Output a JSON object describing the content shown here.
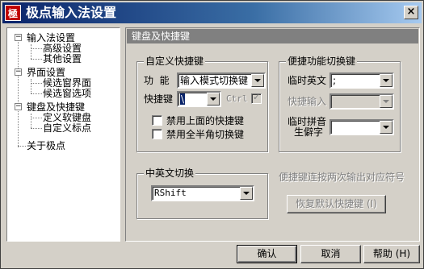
{
  "window": {
    "title": "极点输入法设置",
    "icon_char": "極",
    "close_glyph": "×"
  },
  "tree": {
    "items": [
      {
        "label": "输入法设置",
        "expanded": true
      },
      {
        "label": "高级设置"
      },
      {
        "label": "其他设置"
      },
      {
        "label": "界面设置",
        "expanded": true
      },
      {
        "label": "候选窗界面"
      },
      {
        "label": "候选窗选项"
      },
      {
        "label": "键盘及快捷键",
        "expanded": true
      },
      {
        "label": "定义软键盘"
      },
      {
        "label": "自定义标点"
      },
      {
        "label": "关于极点"
      }
    ],
    "expand_glyph": "−"
  },
  "panel": {
    "header": "键盘及快捷键",
    "custom_hotkey": {
      "title": "自定义快捷键",
      "function_label": "功  能",
      "function_value": "输入模式切换键",
      "hotkey_label": "快捷键",
      "hotkey_value": "\\",
      "ctrl_label": "Ctrl",
      "disable_above_label": "禁用上面的快捷键",
      "disable_fullhalf_label": "禁用全半角切换键"
    },
    "convenient": {
      "title": "便捷功能切换键",
      "temp_english_label": "临时英文",
      "temp_english_value": ";",
      "quick_input_label": "快捷输入",
      "temp_pinyin_label_1": "临时拼音",
      "temp_pinyin_label_2": "生僻字"
    },
    "cn_en_switch": {
      "title": "中英文切换",
      "value": "RShift"
    },
    "hint_text": "便捷键连按两次输出对应符号",
    "restore_button": "恢复默认快捷键 (I)"
  },
  "buttons": {
    "ok": "确认",
    "cancel": "取消",
    "help": "帮助 (H)"
  },
  "colors": {
    "face": "#d4d0c8",
    "title_start": "#0a246a",
    "title_end": "#a6caf0",
    "header_bg": "#808080"
  }
}
